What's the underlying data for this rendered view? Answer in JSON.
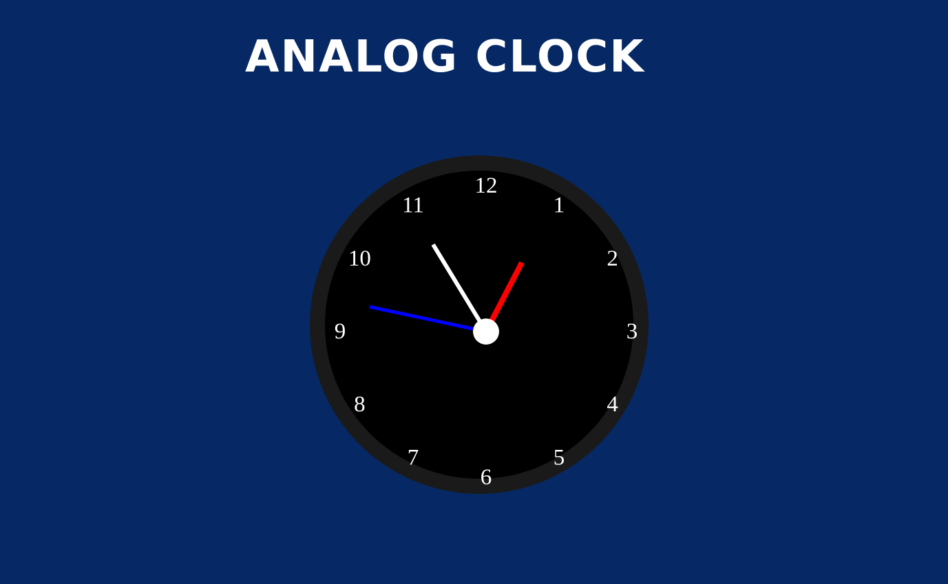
{
  "title": "ANALOG CLOCK",
  "clock": {
    "numbers": [
      "12",
      "1",
      "2",
      "3",
      "4",
      "5",
      "6",
      "7",
      "8",
      "9",
      "10",
      "11"
    ],
    "time": {
      "hours": 12,
      "minutes": 54,
      "seconds": 47
    },
    "colors": {
      "background": "#062965",
      "bezel": "#1a1a1a",
      "face": "#000000",
      "hour_hand": "#ff0000",
      "minute_hand": "#ffffff",
      "second_hand": "#0000ff",
      "center_cap": "#ffffff",
      "numerals": "#ffffff"
    }
  }
}
